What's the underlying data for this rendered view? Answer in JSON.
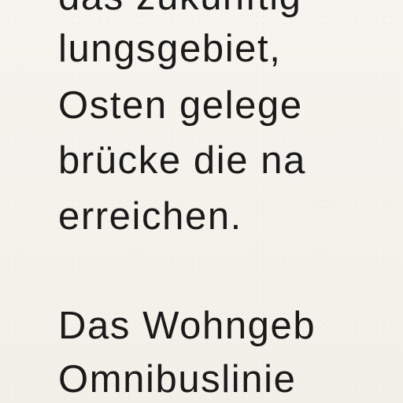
{
  "document": {
    "paragraph_1": [
      "das zukünftig",
      "lungsgebiet,",
      "Osten gelege",
      "brücke die na",
      "erreichen."
    ],
    "paragraph_2": [
      "Das Wohngeb",
      "Omnibuslinie"
    ]
  }
}
